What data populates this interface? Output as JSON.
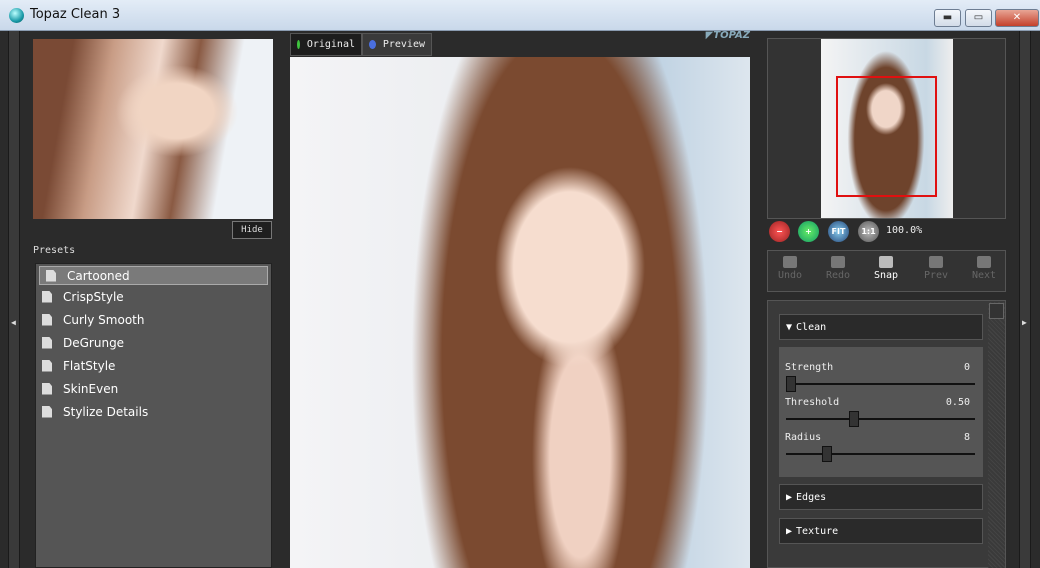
{
  "window": {
    "title": "Topaz Clean 3",
    "min": "▬",
    "max": "▭",
    "close": "✕"
  },
  "left": {
    "hide_label": "Hide",
    "presets_label": "Presets",
    "presets": [
      "Cartooned",
      "CrispStyle",
      "Curly Smooth",
      "DeGrunge",
      "FlatStyle",
      "SkinEven",
      "Stylize Details"
    ],
    "selected": "Cartooned"
  },
  "tabs": [
    {
      "label": "Original",
      "color": "#3ec43e"
    },
    {
      "label": "Preview",
      "color": "#4a6fe0"
    }
  ],
  "logo": "TOPAZ LABS",
  "zoom": {
    "buttons": [
      "−",
      "+",
      "FIT",
      "1:1"
    ],
    "value": "100.0%"
  },
  "history": [
    {
      "label": "Undo",
      "enabled": false
    },
    {
      "label": "Redo",
      "enabled": false
    },
    {
      "label": "Snap",
      "enabled": true
    },
    {
      "label": "Prev",
      "enabled": false
    },
    {
      "label": "Next",
      "enabled": false
    }
  ],
  "sections": {
    "clean": "Clean",
    "edges": "Edges",
    "texture": "Texture"
  },
  "sliders": [
    {
      "label": "Strength",
      "value": "0",
      "level": 0.0
    },
    {
      "label": "Threshold",
      "value": "0.50",
      "level": 0.35
    },
    {
      "label": "Radius",
      "value": "8",
      "level": 0.2
    }
  ],
  "colors": {
    "nav_rect": "#e01010"
  }
}
